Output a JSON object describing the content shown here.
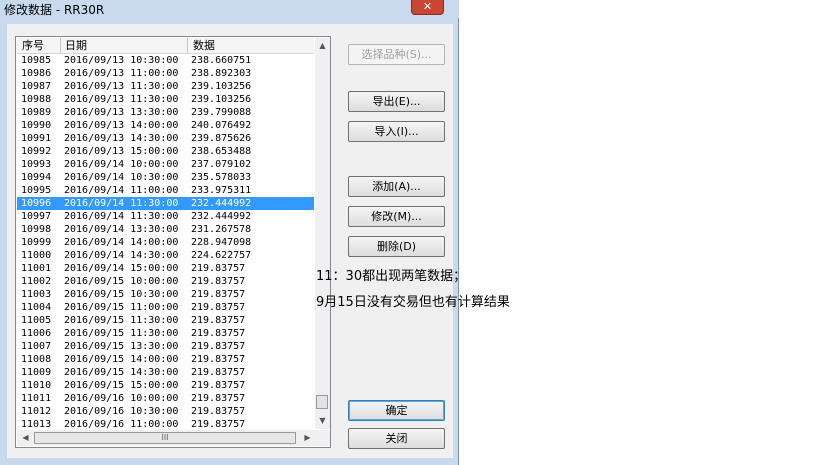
{
  "window": {
    "title": "修改数据 - RR30R",
    "close_glyph": "✕"
  },
  "list": {
    "columns": [
      "序号",
      "日期",
      "数据"
    ],
    "selected_index": 11,
    "rows": [
      [
        "10985",
        "2016/09/13 10:30:00",
        "238.660751"
      ],
      [
        "10986",
        "2016/09/13 11:00:00",
        "238.892303"
      ],
      [
        "10987",
        "2016/09/13 11:30:00",
        "239.103256"
      ],
      [
        "10988",
        "2016/09/13 11:30:00",
        "239.103256"
      ],
      [
        "10989",
        "2016/09/13 13:30:00",
        "239.799088"
      ],
      [
        "10990",
        "2016/09/13 14:00:00",
        "240.076492"
      ],
      [
        "10991",
        "2016/09/13 14:30:00",
        "239.875626"
      ],
      [
        "10992",
        "2016/09/13 15:00:00",
        "238.653488"
      ],
      [
        "10993",
        "2016/09/14 10:00:00",
        "237.079102"
      ],
      [
        "10994",
        "2016/09/14 10:30:00",
        "235.578033"
      ],
      [
        "10995",
        "2016/09/14 11:00:00",
        "233.975311"
      ],
      [
        "10996",
        "2016/09/14 11:30:00",
        "232.444992"
      ],
      [
        "10997",
        "2016/09/14 11:30:00",
        "232.444992"
      ],
      [
        "10998",
        "2016/09/14 13:30:00",
        "231.267578"
      ],
      [
        "10999",
        "2016/09/14 14:00:00",
        "228.947098"
      ],
      [
        "11000",
        "2016/09/14 14:30:00",
        "224.622757"
      ],
      [
        "11001",
        "2016/09/14 15:00:00",
        "219.83757"
      ],
      [
        "11002",
        "2016/09/15 10:00:00",
        "219.83757"
      ],
      [
        "11003",
        "2016/09/15 10:30:00",
        "219.83757"
      ],
      [
        "11004",
        "2016/09/15 11:00:00",
        "219.83757"
      ],
      [
        "11005",
        "2016/09/15 11:30:00",
        "219.83757"
      ],
      [
        "11006",
        "2016/09/15 11:30:00",
        "219.83757"
      ],
      [
        "11007",
        "2016/09/15 13:30:00",
        "219.83757"
      ],
      [
        "11008",
        "2016/09/15 14:00:00",
        "219.83757"
      ],
      [
        "11009",
        "2016/09/15 14:30:00",
        "219.83757"
      ],
      [
        "11010",
        "2016/09/15 15:00:00",
        "219.83757"
      ],
      [
        "11011",
        "2016/09/16 10:00:00",
        "219.83757"
      ],
      [
        "11012",
        "2016/09/16 10:30:00",
        "219.83757"
      ],
      [
        "11013",
        "2016/09/16 11:00:00",
        "219.83757"
      ]
    ]
  },
  "buttons": {
    "select_variety": "选择品种(S)...",
    "export": "导出(E)...",
    "import": "导入(I)...",
    "add": "添加(A)...",
    "modify": "修改(M)...",
    "delete": "删除(D)",
    "ok": "确定",
    "close": "关闭"
  },
  "annotation": {
    "line1": "11：30都出现两笔数据；",
    "line2": "9月15日没有交易但也有计算结果"
  },
  "scroll": {
    "up_arrow": "▲",
    "down_arrow": "▼",
    "left_arrow": "◀",
    "right_arrow": "▶",
    "grip": "III"
  }
}
